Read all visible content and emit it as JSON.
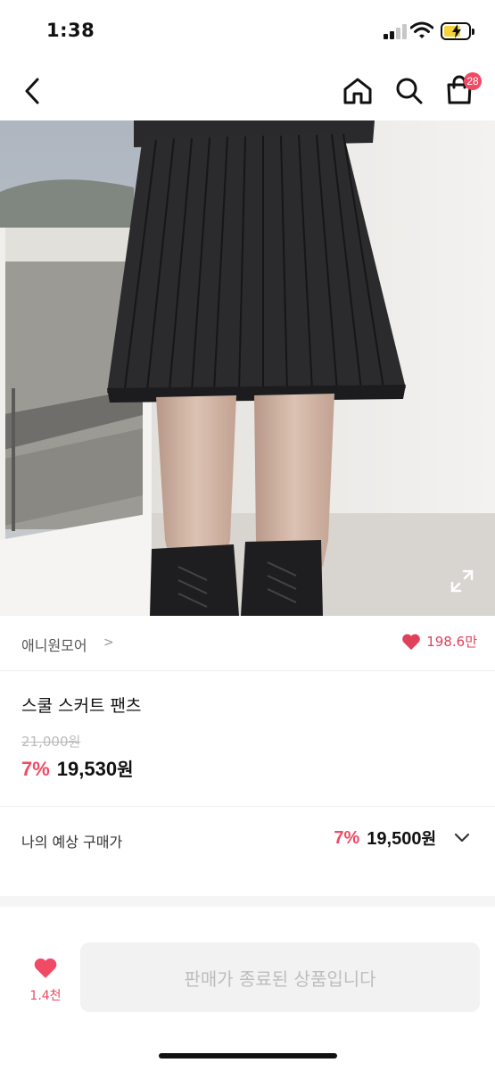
{
  "status_bar": {
    "time": "1:38"
  },
  "nav": {
    "cart_badge": "28"
  },
  "store": {
    "name": "애니원모어",
    "chevron": ">",
    "likes": "198.6만"
  },
  "product": {
    "title": "스쿨 스커트 팬츠",
    "original_price": "21,000원",
    "discount": "7%",
    "sale_price": "19,530",
    "currency": "원"
  },
  "expected": {
    "label": "나의 예상 구매가",
    "discount": "7%",
    "price": "19,500",
    "currency": "원"
  },
  "bottom": {
    "wish_count": "1.4천",
    "soldout_label": "판매가 종료된 상품입니다"
  },
  "colors": {
    "accent": "#f04a64",
    "heart": "#e0405a",
    "disabled_bg": "#f2f2f2",
    "disabled_text": "#bdbdbd"
  },
  "icons": [
    "back-chevron-icon",
    "home-icon",
    "search-icon",
    "shopping-bag-icon",
    "expand-icon",
    "heart-icon",
    "chevron-down-icon"
  ]
}
